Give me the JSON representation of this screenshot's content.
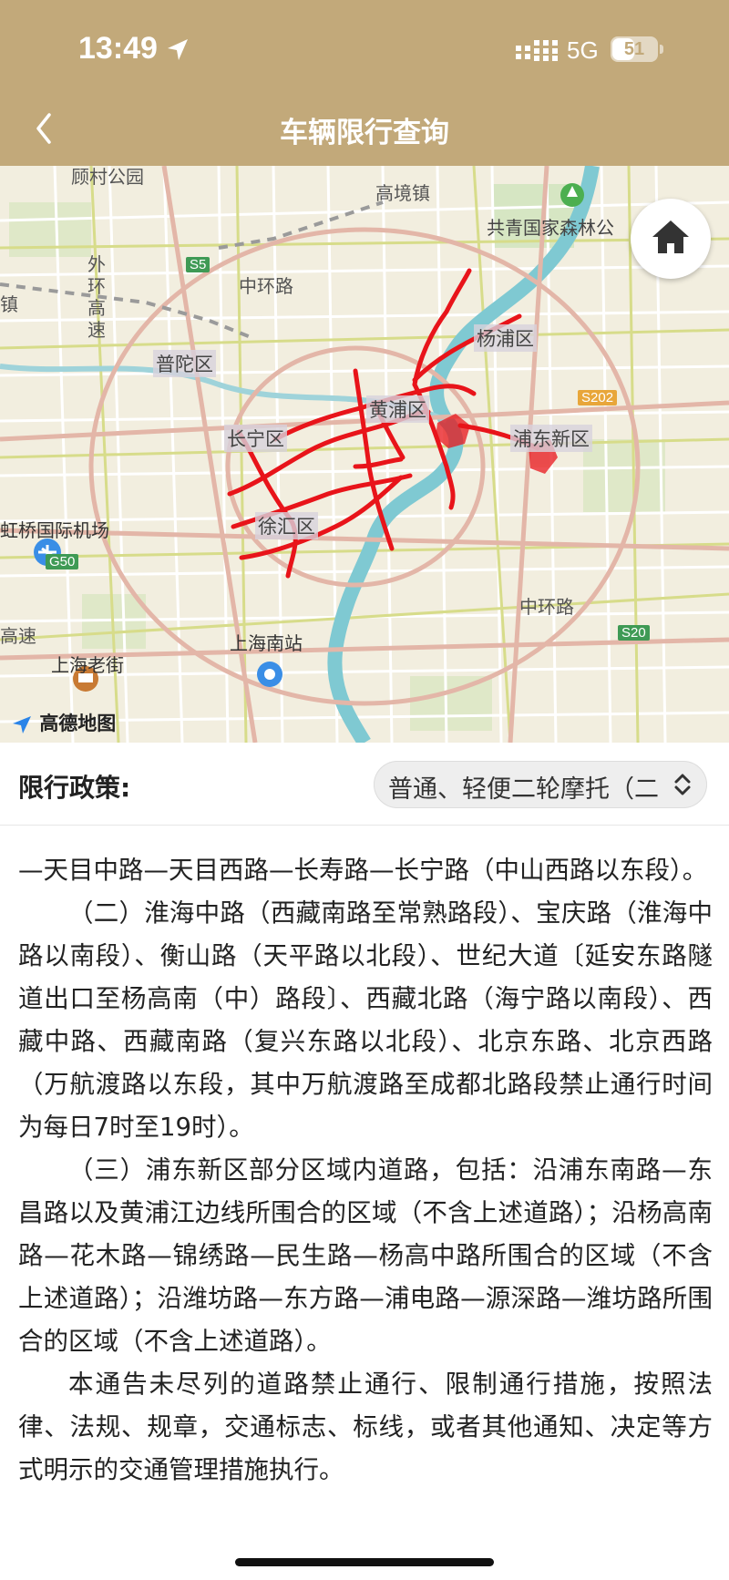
{
  "status_bar": {
    "time": "13:49",
    "network": "5G",
    "battery": "51",
    "battery_level": 0.51
  },
  "header": {
    "title": "车辆限行查询"
  },
  "map": {
    "labels": {
      "park": "顾村公园",
      "town": "高境镇",
      "forest": "共青国家森林公",
      "ring_road_mid": "中环路",
      "ring_road_mid2": "中环路",
      "outer_ring": "外环高速",
      "highway": "高速",
      "zhen": "镇",
      "putuo": "普陀区",
      "yangpu": "杨浦区",
      "huangpu": "黄浦区",
      "changning": "长宁区",
      "pudong": "浦东新区",
      "xuhui": "徐汇区",
      "airport": "虹桥国际机场",
      "south_station": "上海南站",
      "old_street": "上海老街",
      "s5": "S5",
      "s202": "S202",
      "g50": "G50",
      "s20": "S20"
    },
    "logo": "高德地图",
    "home_icon": "home-icon"
  },
  "policy": {
    "label": "限行政策:",
    "selected": "普通、轻便二轮摩托（二"
  },
  "content": {
    "paragraphs": [
      "—天目中路—天目西路—长寿路—长宁路（中山西路以东段）。",
      "（二）淮海中路（西藏南路至常熟路段）、宝庆路（淮海中路以南段）、衡山路（天平路以北段）、世纪大道〔延安东路隧道出口至杨高南（中）路段〕、西藏北路（海宁路以南段）、西藏中路、西藏南路（复兴东路以北段）、北京东路、北京西路（万航渡路以东段，其中万航渡路至成都北路段禁止通行时间为每日7时至19时）。",
      "（三）浦东新区部分区域内道路，包括：沿浦东南路—东昌路以及黄浦江边线所围合的区域（不含上述道路）；沿杨高南路—花木路—锦绣路—民生路—杨高中路所围合的区域（不含上述道路）；沿潍坊路—东方路—浦电路—源深路—潍坊路所围合的区域（不含上述道路）。",
      "本通告未尽列的道路禁止通行、限制通行措施，按照法律、法规、规章，交通标志、标线，或者其他通知、决定等方式明示的交通管理措施执行。"
    ]
  },
  "colors": {
    "header": "#c2a97a",
    "restriction": "#e8141a",
    "river": "#7fc9d2",
    "shield_green": "#3f9a55",
    "shield_orange": "#e8a63a"
  }
}
